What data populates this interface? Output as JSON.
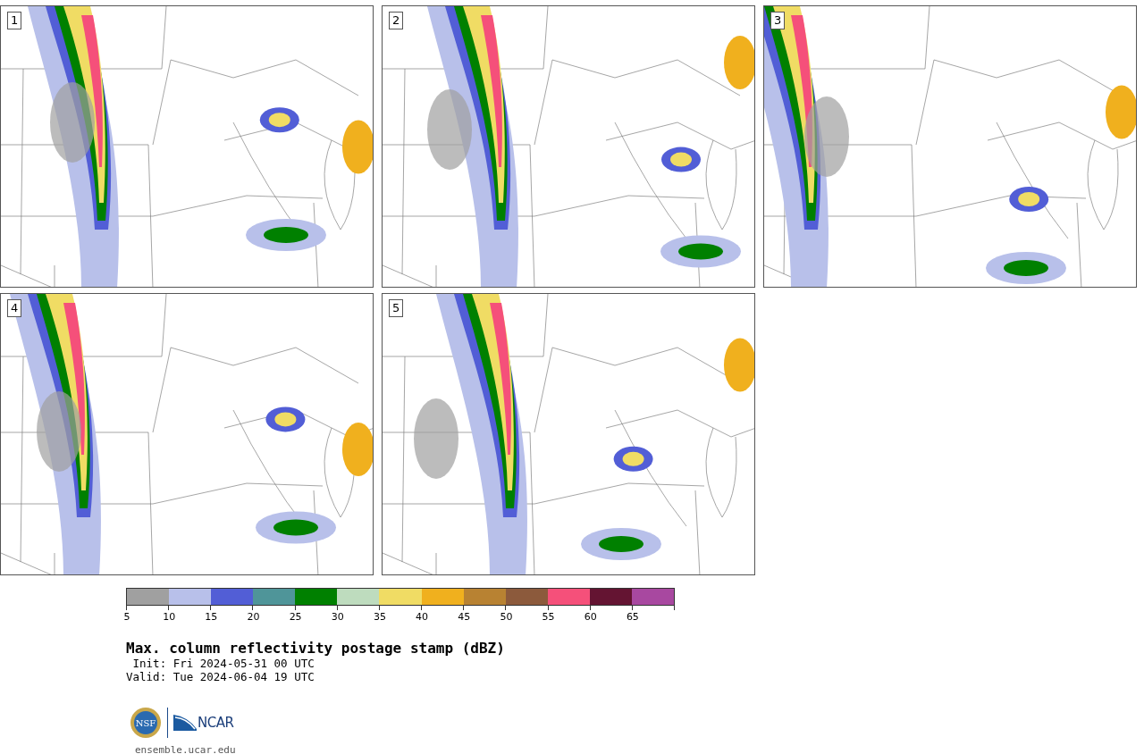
{
  "panels": [
    {
      "number": "1"
    },
    {
      "number": "2"
    },
    {
      "number": "3"
    },
    {
      "number": "4"
    },
    {
      "number": "5"
    }
  ],
  "colorbar": {
    "segments": [
      {
        "color": "#a0a0a0",
        "label": "5"
      },
      {
        "color": "#b8c0ea",
        "label": "10"
      },
      {
        "color": "#525ed6",
        "label": "15"
      },
      {
        "color": "#4f9599",
        "label": "20"
      },
      {
        "color": "#008000",
        "label": "25"
      },
      {
        "color": "#bedcbe",
        "label": "30"
      },
      {
        "color": "#f0dc64",
        "label": "35"
      },
      {
        "color": "#f0b01e",
        "label": "40"
      },
      {
        "color": "#b88232",
        "label": "45"
      },
      {
        "color": "#8c5a3c",
        "label": "50"
      },
      {
        "color": "#f5507a",
        "label": "55"
      },
      {
        "color": "#641432",
        "label": "60"
      },
      {
        "color": "#a848a0",
        "label": "65"
      }
    ]
  },
  "title": "Max. column reflectivity postage stamp (dBZ)",
  "init": " Init: Fri 2024-05-31 00 UTC",
  "valid": "Valid: Tue 2024-06-04 19 UTC",
  "logos": [
    {
      "text": "NSF"
    },
    {
      "text": "NCAR"
    }
  ],
  "url": "ensemble.ucar.edu"
}
